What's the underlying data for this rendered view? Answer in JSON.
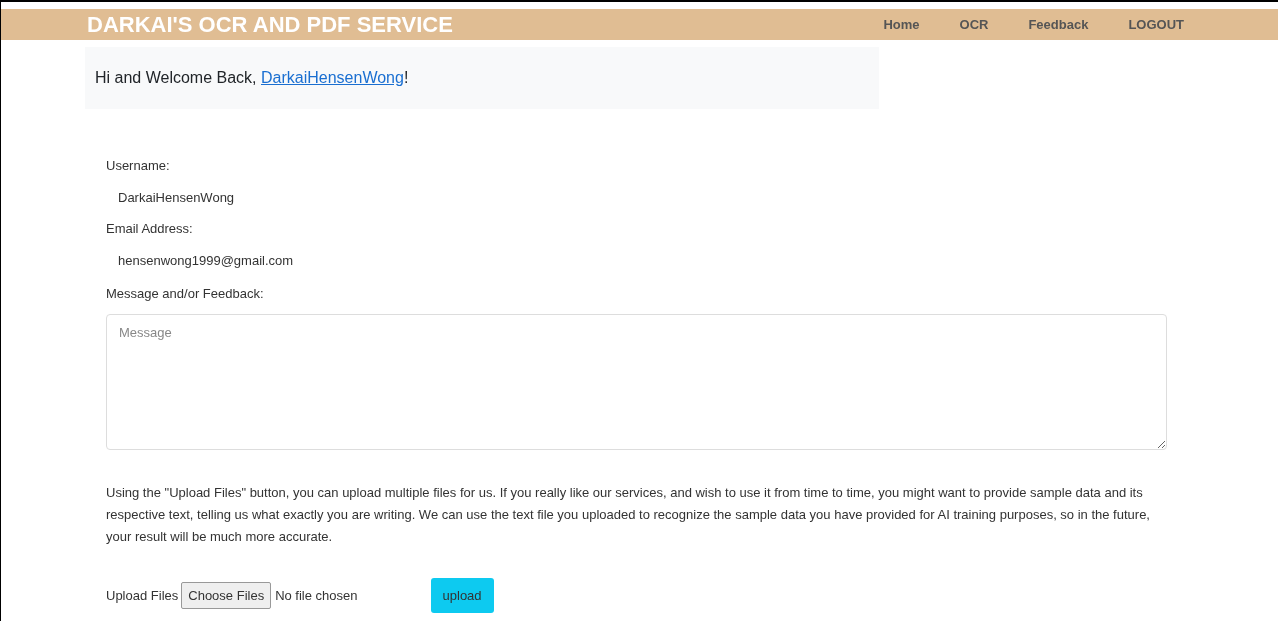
{
  "header": {
    "title": "DARKAI'S OCR AND PDF SERVICE",
    "nav": [
      {
        "label": "Home"
      },
      {
        "label": "OCR"
      },
      {
        "label": "Feedback"
      },
      {
        "label": "LOGOUT"
      }
    ]
  },
  "welcome": {
    "text": "Hi and Welcome Back, ",
    "link": "DarkaiHensenWong",
    "suffix": "!"
  },
  "fields": [
    {
      "label": "Username:",
      "value": "DarkaiHensenWong"
    },
    {
      "label": "Email Address:",
      "value": "hensenwong1999@gmail.com"
    }
  ],
  "message": {
    "label": "Message and/or Feedback:",
    "placeholder": "Message"
  },
  "info": "Using the \"Upload Files\" button, you can upload multiple files for us. If you really like our services, and wish to use it from time to time, you might want to provide sample data and its respective text, telling us what exactly you are writing. We can use the text file you uploaded to recognize the sample data you have provided for AI training purposes, so in the future, your result will be much more accurate.",
  "upload": {
    "label": "Upload Files",
    "choose": "Choose Files",
    "status": "No file chosen",
    "button": "upload"
  }
}
